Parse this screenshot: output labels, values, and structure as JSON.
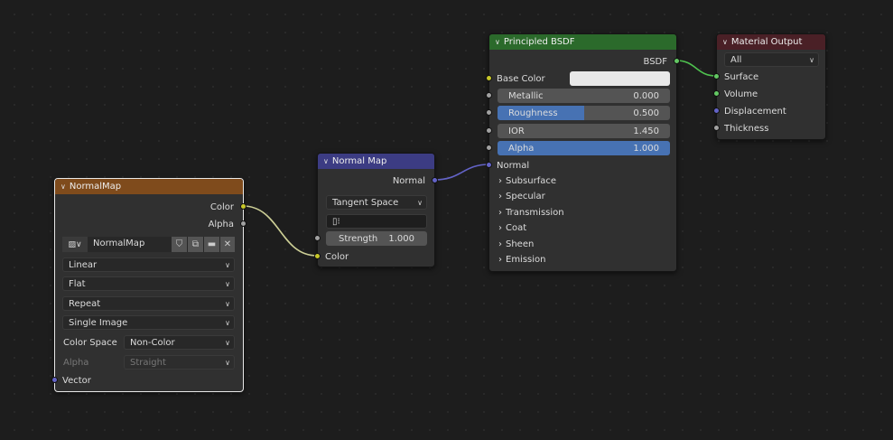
{
  "colors": {
    "image_header": "#7f4b1c",
    "normalmap_header": "#3c3c83",
    "bsdf_header": "#2b6a2b",
    "output_header": "#4a2026",
    "link_color": "#cdcf96",
    "link_normal": "#6363c7",
    "link_shader": "#4fc24f",
    "slider_fill": "#4772b3"
  },
  "image_node": {
    "title": "NormalMap",
    "outputs": [
      "Color",
      "Alpha"
    ],
    "image_name": "NormalMap",
    "interpolation": "Linear",
    "projection": "Flat",
    "extension": "Repeat",
    "source": "Single Image",
    "color_space_label": "Color Space",
    "color_space": "Non-Color",
    "alpha_label": "Alpha",
    "alpha_mode": "Straight",
    "input": "Vector"
  },
  "normal_map": {
    "title": "Normal Map",
    "output": "Normal",
    "space": "Tangent Space",
    "strength_label": "Strength",
    "strength": "1.000",
    "input": "Color"
  },
  "bsdf": {
    "title": "Principled BSDF",
    "output": "BSDF",
    "base_color_label": "Base Color",
    "metallic_label": "Metallic",
    "metallic": "0.000",
    "roughness_label": "Roughness",
    "roughness": "0.500",
    "roughness_fraction": 0.5,
    "ior_label": "IOR",
    "ior": "1.450",
    "alpha_label": "Alpha",
    "alpha": "1.000",
    "normal_label": "Normal",
    "panels": [
      "Subsurface",
      "Specular",
      "Transmission",
      "Coat",
      "Sheen",
      "Emission"
    ]
  },
  "output": {
    "title": "Material Output",
    "target": "All",
    "inputs": [
      "Surface",
      "Volume",
      "Displacement",
      "Thickness"
    ]
  }
}
